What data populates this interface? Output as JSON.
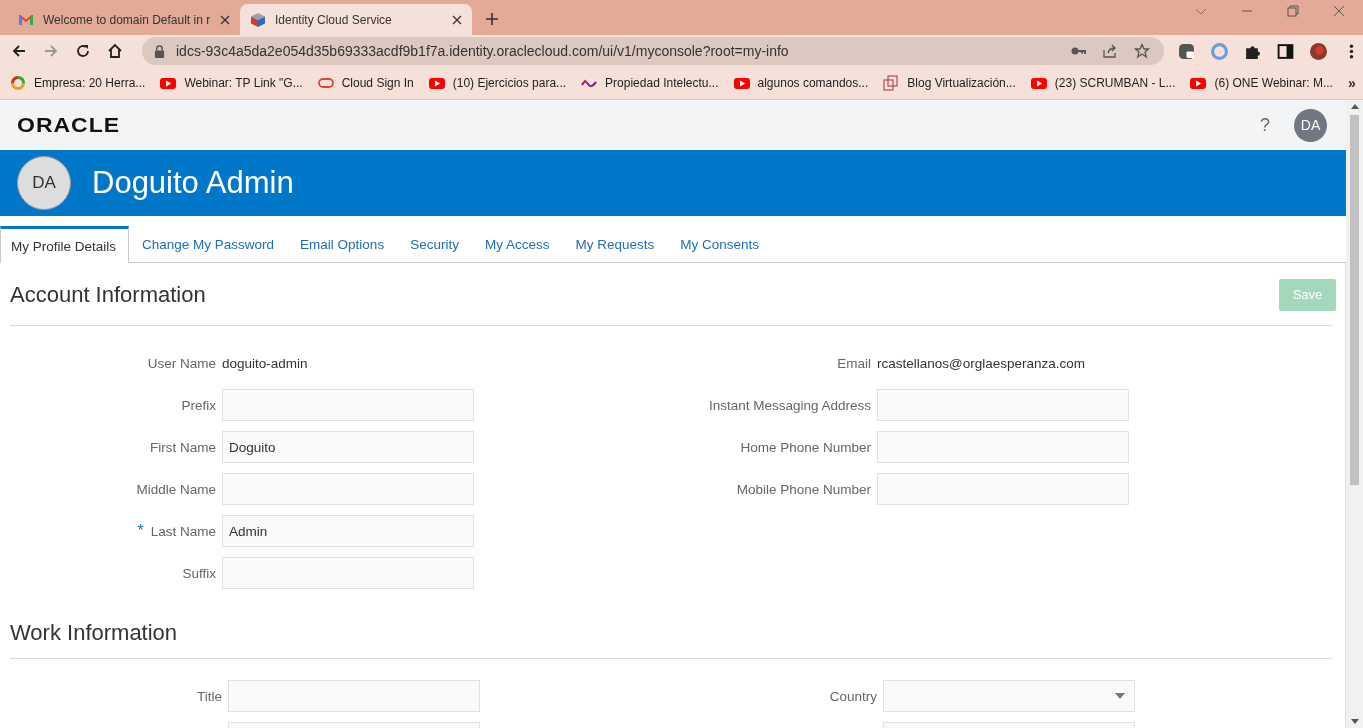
{
  "browser": {
    "tabs": [
      {
        "title": "Welcome to domain Default in r",
        "kind": "mail",
        "selected": false
      },
      {
        "title": "Identity Cloud Service",
        "kind": "cube",
        "selected": true
      }
    ],
    "address": "idcs-93c4a5da2e054d35b69333acdf9b1f7a.identity.oraclecloud.com/ui/v1/myconsole?root=my-info",
    "bookmarks": [
      {
        "label": "Empresa: 20 Herra...",
        "kind": "ring"
      },
      {
        "label": "Webinar: TP Link \"G...",
        "kind": "video"
      },
      {
        "label": "Cloud Sign In",
        "kind": "pill"
      },
      {
        "label": "(10) Ejercicios para...",
        "kind": "video"
      },
      {
        "label": "Propiedad Intelectu...",
        "kind": "mark"
      },
      {
        "label": "algunos comandos...",
        "kind": "video"
      },
      {
        "label": "Blog Virtualización...",
        "kind": "squares"
      },
      {
        "label": "(23) SCRUMBAN - L...",
        "kind": "video"
      },
      {
        "label": "(6) ONE Webinar: M...",
        "kind": "video"
      }
    ],
    "more": "»"
  },
  "header": {
    "logo": "ORACLE",
    "help": "?",
    "avatar": "DA"
  },
  "banner": {
    "initials": "DA",
    "name": "Doguito Admin"
  },
  "tabs": [
    {
      "label": "My Profile Details",
      "selected": true
    },
    {
      "label": "Change My Password",
      "selected": false
    },
    {
      "label": "Email Options",
      "selected": false
    },
    {
      "label": "Security",
      "selected": false
    },
    {
      "label": "My Access",
      "selected": false
    },
    {
      "label": "My Requests",
      "selected": false
    },
    {
      "label": "My Consents",
      "selected": false
    }
  ],
  "required_mark": "*",
  "account": {
    "title": "Account Information",
    "save": {
      "label": "Save",
      "disabled": true
    },
    "left": [
      {
        "label": "User Name",
        "kind": "static",
        "value": "doguito-admin",
        "required": false
      },
      {
        "label": "Prefix",
        "kind": "input",
        "required": false
      },
      {
        "label": "First Name",
        "kind": "input",
        "value": "Doguito",
        "required": false
      },
      {
        "label": "Middle Name",
        "kind": "input",
        "required": false
      },
      {
        "label": "Last Name",
        "kind": "input",
        "value": "Admin",
        "required": true
      },
      {
        "label": "Suffix",
        "kind": "input",
        "required": false
      }
    ],
    "right": [
      {
        "label": "Email",
        "kind": "static",
        "value": "rcastellanos@orglaesperanza.com",
        "required": false
      },
      {
        "label": "Instant Messaging Address",
        "kind": "input",
        "required": false
      },
      {
        "label": "Home Phone Number",
        "kind": "input",
        "required": false
      },
      {
        "label": "Mobile Phone Number",
        "kind": "input",
        "required": false
      }
    ]
  },
  "work": {
    "title": "Work Information",
    "left": [
      {
        "label": "Title",
        "kind": "input",
        "required": false
      },
      {
        "kind": "input"
      }
    ],
    "right": [
      {
        "label": "Country",
        "kind": "select",
        "required": false
      },
      {
        "kind": "input"
      }
    ]
  }
}
